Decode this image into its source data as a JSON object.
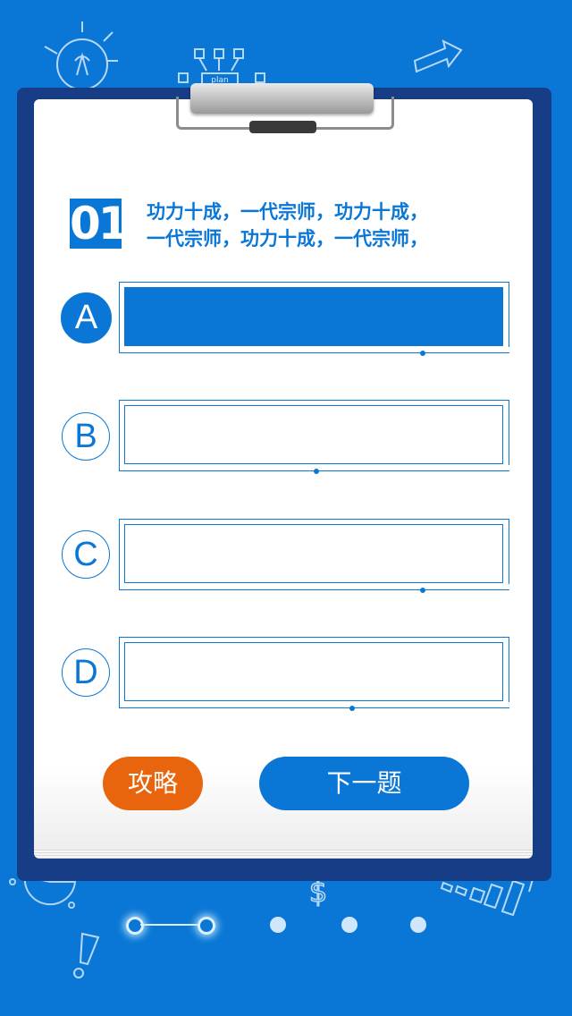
{
  "question": {
    "number": "01",
    "text_line1": "功力十成，一代宗师，功力十成，",
    "text_line2": "一代宗师，功力十成，一代宗师，"
  },
  "options": [
    {
      "letter": "A",
      "text": "",
      "selected": true
    },
    {
      "letter": "B",
      "text": "",
      "selected": false
    },
    {
      "letter": "C",
      "text": "",
      "selected": false
    },
    {
      "letter": "D",
      "text": "",
      "selected": false
    }
  ],
  "buttons": {
    "guide_label": "攻略",
    "next_label": "下一题"
  },
  "pagination": {
    "current": 1,
    "total": 5
  },
  "colors": {
    "background": "#0a77d6",
    "board": "#163d86",
    "accent": "#0a77d6",
    "guide_button": "#e8650d"
  },
  "decorations": {
    "sketch_label": "plan",
    "icons": [
      "lightbulb-icon",
      "arrow-icon",
      "flowchart-icon",
      "pie-chart-icon",
      "dollar-icon",
      "bar-chart-icon",
      "exclamation-icon"
    ]
  }
}
